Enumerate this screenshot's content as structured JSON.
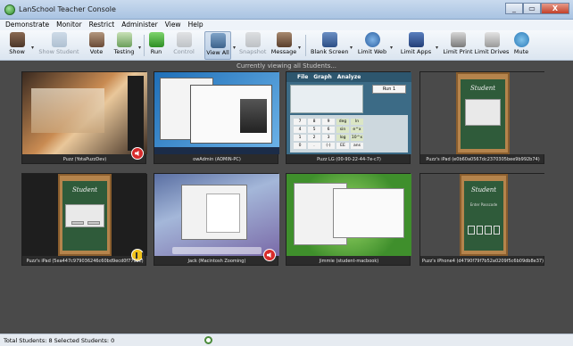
{
  "window": {
    "title": "LanSchool Teacher Console",
    "buttons": [
      "_",
      "▭",
      "X"
    ]
  },
  "menu": [
    "Demonstrate",
    "Monitor",
    "Restrict",
    "Administer",
    "View",
    "Help"
  ],
  "toolbar": [
    {
      "id": "show",
      "label": "Show",
      "icon": "presenter-icon",
      "enabled": true,
      "dropdown": true
    },
    {
      "id": "show_student",
      "label": "Show Student",
      "icon": "student-screen-icon",
      "enabled": false
    },
    {
      "id": "vote",
      "label": "Vote",
      "icon": "vote-icon",
      "enabled": true
    },
    {
      "id": "testing",
      "label": "Testing",
      "icon": "testing-icon",
      "enabled": true,
      "dropdown": true
    },
    {
      "id": "run",
      "label": "Run",
      "icon": "run-icon",
      "enabled": true
    },
    {
      "id": "control",
      "label": "Control",
      "icon": "control-icon",
      "enabled": false
    },
    {
      "id": "view_all",
      "label": "View All",
      "icon": "view-all-icon",
      "enabled": true,
      "active": true,
      "dropdown": true
    },
    {
      "id": "snapshot",
      "label": "Snapshot",
      "icon": "snapshot-icon",
      "enabled": false
    },
    {
      "id": "message",
      "label": "Message",
      "icon": "message-icon",
      "enabled": true,
      "dropdown": true
    },
    {
      "id": "blank_screen",
      "label": "Blank Screen",
      "icon": "blank-screen-icon",
      "enabled": true,
      "dropdown": true
    },
    {
      "id": "limit_web",
      "label": "Limit Web",
      "icon": "limit-web-icon",
      "enabled": true,
      "dropdown": true
    },
    {
      "id": "limit_apps",
      "label": "Limit Apps",
      "icon": "limit-apps-icon",
      "enabled": true,
      "dropdown": true
    },
    {
      "id": "limit_print",
      "label": "Limit Print",
      "icon": "printer-icon",
      "enabled": true
    },
    {
      "id": "limit_drives",
      "label": "Limit Drives",
      "icon": "drive-icon",
      "enabled": true
    },
    {
      "id": "mute",
      "label": "Mute",
      "icon": "speaker-icon",
      "enabled": true
    }
  ],
  "view": {
    "title": "Currently viewing all Students...",
    "thumbnails": [
      {
        "caption": "Puzz (YotaPuzzDev)",
        "screen": "android-phone",
        "badge": "sound"
      },
      {
        "caption": "owAdmin (ADMIN-PC)",
        "screen": "windows-desktop",
        "badge": "none"
      },
      {
        "caption": "Puzz LG (00-90-22-44-7e-c7)",
        "screen": "calculator",
        "badge": "none"
      },
      {
        "caption": "Puzz's iPad (e0b60a0567dc2370305bee9b992b74)",
        "screen": "ipad-student",
        "badge": "none"
      },
      {
        "caption": "Puzz's iPad (5ea447c979036246c60bd9ecd0f7792c)",
        "screen": "ipad-dialog",
        "badge": "media"
      },
      {
        "caption": "Jack (Macintosh Zooming)",
        "screen": "mac-desktop",
        "badge": "sound"
      },
      {
        "caption": "Jimmie (student-macbook)",
        "screen": "mac-green",
        "badge": "none"
      },
      {
        "caption": "Puzz's iPhone4 (d4790f79f7b52a0209f5c6b09db8e37)",
        "screen": "iphone-lock",
        "badge": "none"
      }
    ],
    "calculator": {
      "menu": [
        "File",
        "Graph",
        "Analyze"
      ],
      "run_label": "Run 1",
      "keys": [
        "deg",
        "sin",
        "log",
        "ln",
        "e^x",
        "10^x",
        "7",
        "8",
        "9",
        "4",
        "5",
        "6",
        "1",
        "2",
        "3",
        "0",
        ".",
        "(-)",
        "EE",
        "ans"
      ]
    },
    "ipad": {
      "word": "Student"
    },
    "iphone": {
      "word": "Student",
      "passcode_title": "Enter Passcode"
    }
  },
  "status": {
    "text": "Total Students: 8  Selected Students: 0"
  },
  "colors": {
    "view_bg": "#4a4a4a",
    "toolbar_active": "#b9cde5",
    "badge_sound": "#d72b2b"
  }
}
